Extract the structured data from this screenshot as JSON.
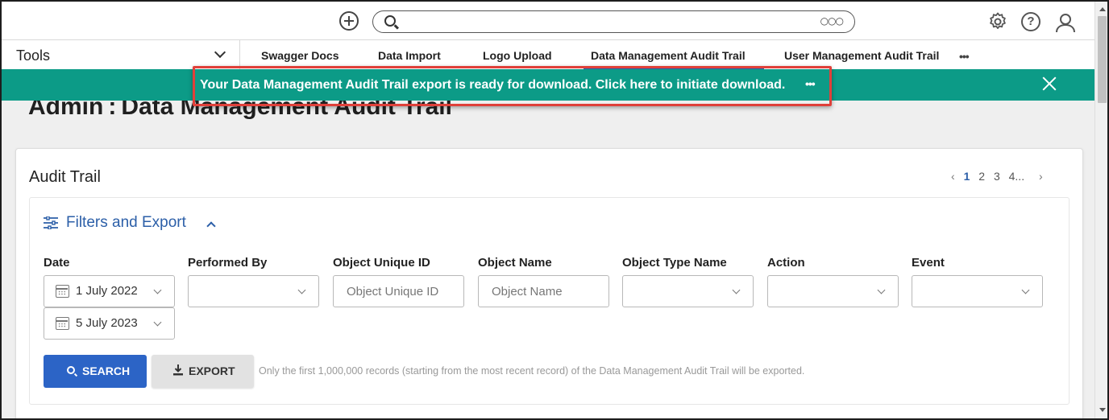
{
  "header": {
    "search_placeholder": "",
    "search_options_icon": "ellipsis-icon",
    "icons": [
      "plus-circle-icon",
      "search-icon",
      "gear-icon",
      "help-icon",
      "user-icon"
    ]
  },
  "tools": {
    "label": "Tools",
    "tabs": [
      {
        "label": "Swagger Docs"
      },
      {
        "label": "Data Import"
      },
      {
        "label": "Logo Upload"
      },
      {
        "label": "Data Management Audit Trail",
        "active": true
      },
      {
        "label": "User Management Audit Trail"
      }
    ],
    "more": "•••"
  },
  "banner": {
    "message": "Your Data Management Audit Trail export is ready for download. Click here to initiate download.",
    "dots": "•••",
    "color": "#0c9b87",
    "highlight_color": "#e0403a"
  },
  "page": {
    "title": "Admin : Data Management Audit Trail"
  },
  "card": {
    "title": "Audit Trail",
    "pagination": {
      "prev": "‹",
      "pages": [
        "1",
        "2",
        "3",
        "4"
      ],
      "current": "1",
      "ellipsis": "...",
      "next": "›"
    },
    "filters": {
      "heading": "Filters and Export",
      "labels": {
        "date": "Date",
        "performed_by": "Performed By",
        "object_unique_id": "Object Unique ID",
        "object_name": "Object Name",
        "object_type_name": "Object Type Name",
        "action": "Action",
        "event": "Event"
      },
      "date_from": "1 July 2022",
      "date_to": "5 July 2023",
      "object_unique_id_placeholder": "Object Unique ID",
      "object_name_placeholder": "Object Name"
    },
    "buttons": {
      "search": "SEARCH",
      "export": "EXPORT"
    },
    "export_note": "Only the first 1,000,000 records (starting from the most recent record) of the Data Management Audit Trail will be exported.",
    "accent_color": "#2c64c6"
  }
}
